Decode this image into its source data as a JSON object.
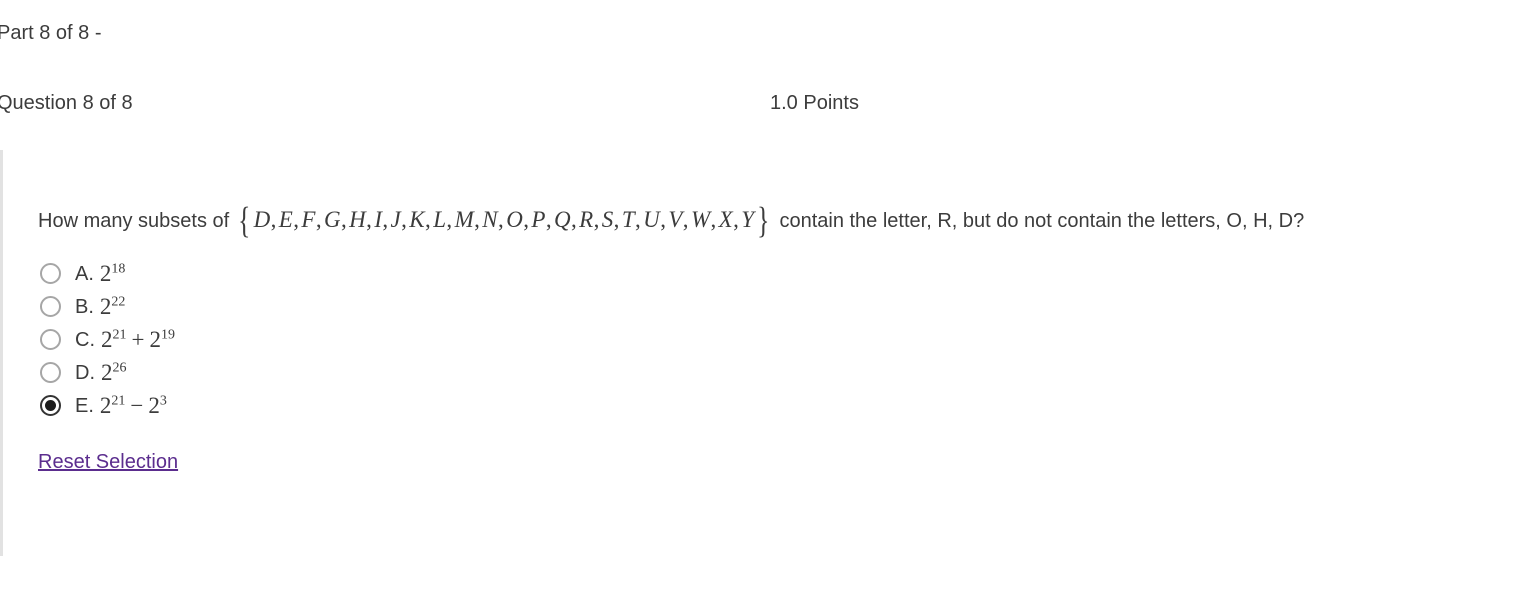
{
  "header": {
    "part_label": "Part 8 of 8 -",
    "question_counter": "Question 8 of 8",
    "points": "1.0 Points"
  },
  "question": {
    "text_before_set": "How many subsets of",
    "set_open": "{",
    "set_elements": [
      "D",
      "E",
      "F",
      "G",
      "H",
      "I",
      "J",
      "K",
      "L",
      "M",
      "N",
      "O",
      "P",
      "Q",
      "R",
      "S",
      "T",
      "U",
      "V",
      "W",
      "X",
      "Y"
    ],
    "set_close": "}",
    "text_after_set": "contain the letter, R, but do not contain the letters, O, H, D?"
  },
  "options": [
    {
      "letter": "A.",
      "base": "2",
      "exponent": "18",
      "operator": "",
      "base2": "",
      "exponent2": "",
      "selected": false
    },
    {
      "letter": "B.",
      "base": "2",
      "exponent": "22",
      "operator": "",
      "base2": "",
      "exponent2": "",
      "selected": false
    },
    {
      "letter": "C.",
      "base": "2",
      "exponent": "21",
      "operator": "+",
      "base2": "2",
      "exponent2": "19",
      "selected": false
    },
    {
      "letter": "D.",
      "base": "2",
      "exponent": "26",
      "operator": "",
      "base2": "",
      "exponent2": "",
      "selected": false
    },
    {
      "letter": "E.",
      "base": "2",
      "exponent": "21",
      "operator": "−",
      "base2": "2",
      "exponent2": "3",
      "selected": true
    }
  ],
  "actions": {
    "reset_label": "Reset Selection"
  },
  "colors": {
    "text": "#3c3c3c",
    "link": "#5b2d8e",
    "panel_border": "#e2e2e2",
    "radio_unselected": "#a6a6a6",
    "radio_selected": "#1c1c1c"
  }
}
